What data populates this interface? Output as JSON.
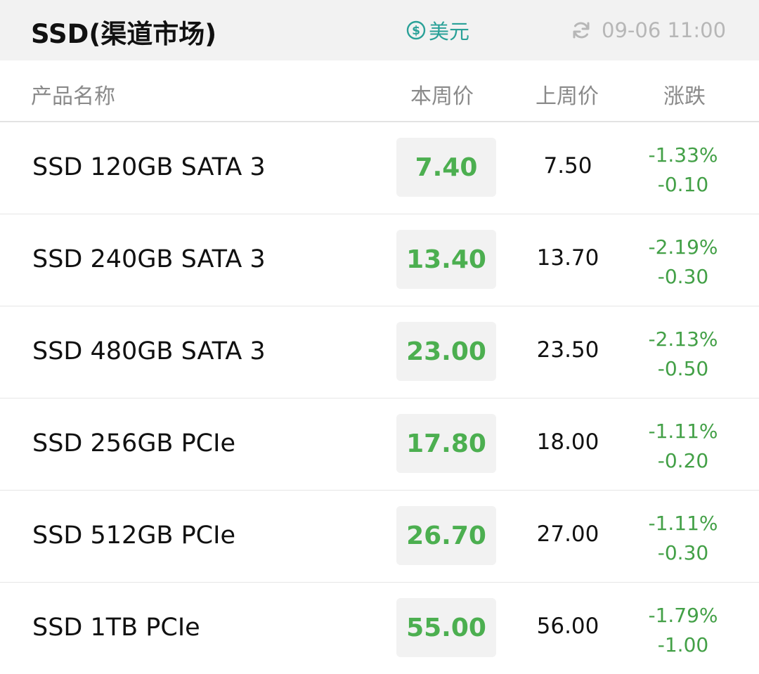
{
  "header": {
    "title": "SSD(渠道市场)",
    "currency_label": "美元",
    "updated_at": "09-06 11:00"
  },
  "columns": {
    "name": "产品名称",
    "this_week": "本周价",
    "last_week": "上周价",
    "change": "涨跌"
  },
  "colors": {
    "price_green": "#4caf50",
    "change_green": "#43a047",
    "currency_teal": "#2aa198",
    "header_bg": "#f2f2f2"
  },
  "icons": {
    "currency": "dollar-circle-icon",
    "refresh": "refresh-icon"
  },
  "rows": [
    {
      "name": "SSD 120GB SATA 3",
      "this_week": "7.40",
      "last_week": "7.50",
      "change_pct": "-1.33%",
      "change_abs": "-0.10"
    },
    {
      "name": "SSD 240GB SATA 3",
      "this_week": "13.40",
      "last_week": "13.70",
      "change_pct": "-2.19%",
      "change_abs": "-0.30"
    },
    {
      "name": "SSD 480GB SATA 3",
      "this_week": "23.00",
      "last_week": "23.50",
      "change_pct": "-2.13%",
      "change_abs": "-0.50"
    },
    {
      "name": "SSD 256GB PCIe",
      "this_week": "17.80",
      "last_week": "18.00",
      "change_pct": "-1.11%",
      "change_abs": "-0.20"
    },
    {
      "name": "SSD 512GB PCIe",
      "this_week": "26.70",
      "last_week": "27.00",
      "change_pct": "-1.11%",
      "change_abs": "-0.30"
    },
    {
      "name": "SSD 1TB PCIe",
      "this_week": "55.00",
      "last_week": "56.00",
      "change_pct": "-1.79%",
      "change_abs": "-1.00"
    }
  ]
}
